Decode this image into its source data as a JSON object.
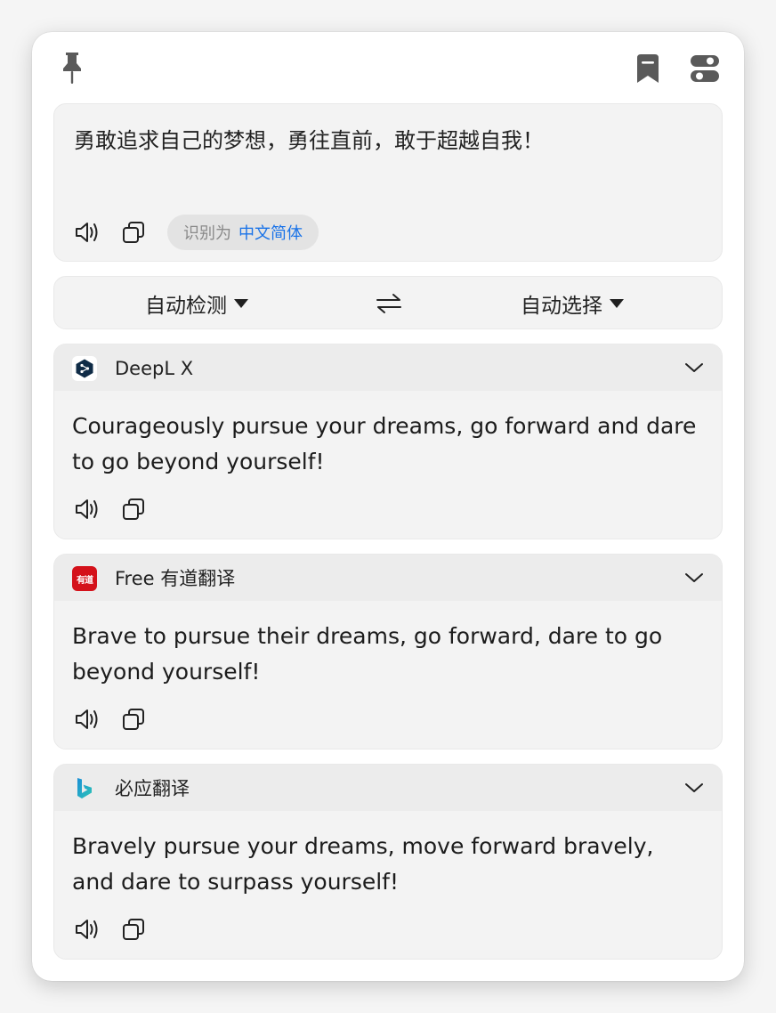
{
  "source": {
    "text": "勇敢追求自己的梦想，勇往直前，敢于超越自我！",
    "detected_prefix": "识别为",
    "detected_language": "中文简体"
  },
  "languages": {
    "from": "自动检测",
    "to": "自动选择"
  },
  "results": [
    {
      "service": "DeepL X",
      "icon": "deepl-logo-icon",
      "text": "Courageously pursue your dreams, go forward and dare to go beyond yourself!"
    },
    {
      "service": "Free 有道翻译",
      "icon": "youdao-logo-icon",
      "logo_text": "有道",
      "text": "Brave to pursue their dreams, go forward, dare to go beyond yourself!"
    },
    {
      "service": "必应翻译",
      "icon": "bing-logo-icon",
      "text": "Bravely pursue your dreams, move forward bravely, and dare to surpass yourself!"
    }
  ],
  "icons": {
    "pin": "pin-icon",
    "bookmark": "bookmark-icon",
    "settings": "toggle-settings-icon",
    "speaker": "speaker-icon",
    "copy": "copy-icon",
    "swap": "swap-arrows-icon",
    "chevron": "chevron-down-icon"
  },
  "colors": {
    "accent_blue": "#1a73e8",
    "panel_bg": "#f3f3f3",
    "header_bg": "#ececec",
    "deepl_navy": "#0f2b46",
    "youdao_red": "#d4111a",
    "bing_blue": "#1b8fd6"
  }
}
